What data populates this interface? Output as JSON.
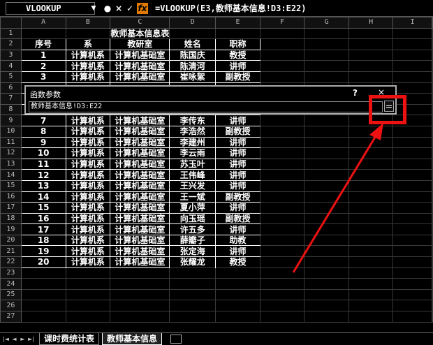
{
  "formula_bar": {
    "name_box": "VLOOKUP",
    "cancel_symbol": "×",
    "enter_symbol": "✓",
    "fx_symbol": "fx",
    "formula": "=VLOOKUP(E3,教师基本信息!D3:E22)"
  },
  "columns": [
    "A",
    "B",
    "C",
    "D",
    "E",
    "F",
    "G",
    "H",
    "I"
  ],
  "rows": [
    {
      "n": "1",
      "cells": [
        "",
        "",
        "教师基本信息表",
        "",
        "",
        "",
        "",
        "",
        ""
      ]
    },
    {
      "n": "2",
      "cells": [
        "序号",
        "系",
        "教研室",
        "姓名",
        "职称",
        "",
        "",
        "",
        ""
      ]
    },
    {
      "n": "3",
      "cells": [
        "1",
        "计算机系",
        "计算机基础室",
        "陈国庆",
        "教授",
        "",
        "",
        "",
        ""
      ]
    },
    {
      "n": "4",
      "cells": [
        "2",
        "计算机系",
        "计算机基础室",
        "陈清河",
        "讲师",
        "",
        "",
        "",
        ""
      ]
    },
    {
      "n": "5",
      "cells": [
        "3",
        "计算机系",
        "计算机基础室",
        "崔咏絮",
        "副教授",
        "",
        "",
        "",
        ""
      ]
    },
    {
      "n": "6",
      "cells": [
        "",
        "",
        "",
        "",
        "",
        "",
        "",
        "",
        ""
      ]
    },
    {
      "n": "7",
      "cells": [
        "",
        "",
        "",
        "",
        "",
        "",
        "",
        "",
        ""
      ]
    },
    {
      "n": "8",
      "cells": [
        "",
        "",
        "",
        "",
        "",
        "",
        "",
        "",
        ""
      ]
    },
    {
      "n": "9",
      "cells": [
        "7",
        "计算机系",
        "计算机基础室",
        "李传东",
        "讲师",
        "",
        "",
        "",
        ""
      ]
    },
    {
      "n": "10",
      "cells": [
        "8",
        "计算机系",
        "计算机基础室",
        "李浩然",
        "副教授",
        "",
        "",
        "",
        ""
      ]
    },
    {
      "n": "11",
      "cells": [
        "9",
        "计算机系",
        "计算机基础室",
        "李建州",
        "讲师",
        "",
        "",
        "",
        ""
      ]
    },
    {
      "n": "12",
      "cells": [
        "10",
        "计算机系",
        "计算机基础室",
        "李云雨",
        "讲师",
        "",
        "",
        "",
        ""
      ]
    },
    {
      "n": "13",
      "cells": [
        "11",
        "计算机系",
        "计算机基础室",
        "苏玉叶",
        "讲师",
        "",
        "",
        "",
        ""
      ]
    },
    {
      "n": "14",
      "cells": [
        "12",
        "计算机系",
        "计算机基础室",
        "王伟峰",
        "讲师",
        "",
        "",
        "",
        ""
      ]
    },
    {
      "n": "15",
      "cells": [
        "13",
        "计算机系",
        "计算机基础室",
        "王兴发",
        "讲师",
        "",
        "",
        "",
        ""
      ]
    },
    {
      "n": "16",
      "cells": [
        "14",
        "计算机系",
        "计算机基础室",
        "王一斌",
        "副教授",
        "",
        "",
        "",
        ""
      ]
    },
    {
      "n": "17",
      "cells": [
        "15",
        "计算机系",
        "计算机基础室",
        "夏小萍",
        "讲师",
        "",
        "",
        "",
        ""
      ]
    },
    {
      "n": "18",
      "cells": [
        "16",
        "计算机系",
        "计算机基础室",
        "向玉瑶",
        "副教授",
        "",
        "",
        "",
        ""
      ]
    },
    {
      "n": "19",
      "cells": [
        "17",
        "计算机系",
        "计算机基础室",
        "许五多",
        "讲师",
        "",
        "",
        "",
        ""
      ]
    },
    {
      "n": "20",
      "cells": [
        "18",
        "计算机系",
        "计算机基础室",
        "薛瓣子",
        "助教",
        "",
        "",
        "",
        ""
      ]
    },
    {
      "n": "21",
      "cells": [
        "19",
        "计算机系",
        "计算机基础室",
        "张定海",
        "讲师",
        "",
        "",
        "",
        ""
      ]
    },
    {
      "n": "22",
      "cells": [
        "20",
        "计算机系",
        "计算机基础室",
        "张耀龙",
        "教授",
        "",
        "",
        "",
        ""
      ]
    },
    {
      "n": "23",
      "cells": [
        "",
        "",
        "",
        "",
        "",
        "",
        "",
        "",
        ""
      ]
    },
    {
      "n": "24",
      "cells": [
        "",
        "",
        "",
        "",
        "",
        "",
        "",
        "",
        ""
      ]
    },
    {
      "n": "25",
      "cells": [
        "",
        "",
        "",
        "",
        "",
        "",
        "",
        "",
        ""
      ]
    },
    {
      "n": "26",
      "cells": [
        "",
        "",
        "",
        "",
        "",
        "",
        "",
        "",
        ""
      ]
    },
    {
      "n": "27",
      "cells": [
        "",
        "",
        "",
        "",
        "",
        "",
        "",
        "",
        ""
      ]
    }
  ],
  "dialog": {
    "title": "函数参数",
    "help": "?",
    "close": "×",
    "input_value": "教师基本信息!D3:E22"
  },
  "sheet_tabs": {
    "nav": [
      "|◄",
      "◄",
      "►",
      "►|"
    ],
    "tabs": [
      "课时费统计表",
      "教师基本信息"
    ]
  },
  "colors": {
    "background": "#000000",
    "annotation": "#ee1111",
    "fx": "#e07a00"
  }
}
